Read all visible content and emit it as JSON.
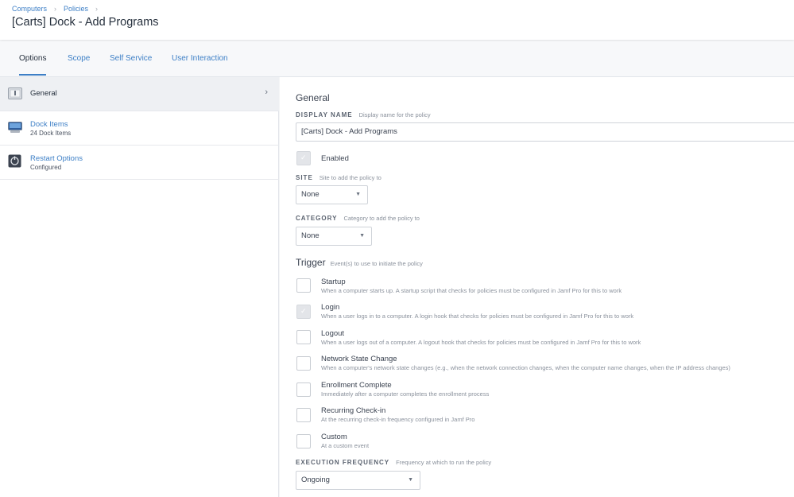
{
  "breadcrumb": {
    "items": [
      "Computers",
      "Policies"
    ]
  },
  "page_title": "[Carts] Dock - Add Programs",
  "tabs": [
    {
      "label": "Options"
    },
    {
      "label": "Scope"
    },
    {
      "label": "Self Service"
    },
    {
      "label": "User Interaction"
    }
  ],
  "sidebar": {
    "items": [
      {
        "label": "General",
        "sub": ""
      },
      {
        "label": "Dock Items",
        "sub": "24 Dock Items"
      },
      {
        "label": "Restart Options",
        "sub": "Configured"
      }
    ]
  },
  "main": {
    "section_title": "General",
    "display_name": {
      "label": "DISPLAY NAME",
      "hint": "Display name for the policy",
      "value": "[Carts] Dock - Add Programs"
    },
    "enabled": {
      "label": "Enabled",
      "checked": true
    },
    "site": {
      "label": "SITE",
      "hint": "Site to add the policy to",
      "value": "None"
    },
    "category": {
      "label": "CATEGORY",
      "hint": "Category to add the policy to",
      "value": "None"
    },
    "trigger": {
      "title": "Trigger",
      "hint": "Event(s) to use to initiate the policy",
      "options": [
        {
          "label": "Startup",
          "desc": "When a computer starts up. A startup script that checks for policies must be configured in Jamf Pro for this to work",
          "checked": false
        },
        {
          "label": "Login",
          "desc": "When a user logs in to a computer. A login hook that checks for policies must be configured in Jamf Pro for this to work",
          "checked": true
        },
        {
          "label": "Logout",
          "desc": "When a user logs out of a computer. A logout hook that checks for policies must be configured in Jamf Pro for this to work",
          "checked": false
        },
        {
          "label": "Network State Change",
          "desc": "When a computer's network state changes (e.g., when the network connection changes, when the computer name changes, when the IP address changes)",
          "checked": false
        },
        {
          "label": "Enrollment Complete",
          "desc": "Immediately after a computer completes the enrollment process",
          "checked": false
        },
        {
          "label": "Recurring Check-in",
          "desc": "At the recurring check-in frequency configured in Jamf Pro",
          "checked": false
        },
        {
          "label": "Custom",
          "desc": "At a custom event",
          "checked": false
        }
      ]
    },
    "execution_frequency": {
      "label": "EXECUTION FREQUENCY",
      "hint": "Frequency at which to run the policy",
      "value": "Ongoing"
    }
  },
  "colors": {
    "accent": "#3d7fc6",
    "text": "#3a4250"
  }
}
